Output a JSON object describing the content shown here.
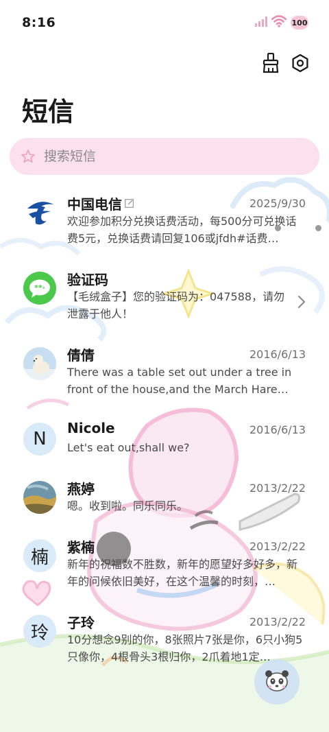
{
  "status_bar": {
    "time": "8:16",
    "battery": "100"
  },
  "header": {
    "title": "短信",
    "clean_icon": "brush-icon",
    "settings_icon": "gear-icon"
  },
  "search": {
    "placeholder": "搜索短信",
    "icon": "star-icon"
  },
  "conversations": [
    {
      "name": "中国电信",
      "date": "2025/9/30",
      "preview": "欢迎参加积分兑换话费活动，每500分可兑换话费5元，兑换话费请回复106或jfdh#话费…",
      "avatar": "china-telecom-logo",
      "has_edit_mark": true
    },
    {
      "name": "验证码",
      "date": "",
      "preview": "【毛绒盒子】您的验证码为：047588，请勿泄露于他人！",
      "avatar": "message-bubble-icon",
      "has_chevron": true
    },
    {
      "name": "倩倩",
      "date": "2016/6/13",
      "preview": "There was a table set out under a tree in front of the house,and the March Hare an…",
      "avatar": "polar-bear-photo"
    },
    {
      "name": "Nicole",
      "date": "2016/6/13",
      "preview": "Let's eat out,shall we?",
      "avatar_letter": "N"
    },
    {
      "name": "燕婷",
      "date": "2013/2/22",
      "preview": "嗯。收到啦。同乐同乐。",
      "avatar": "landscape-photo"
    },
    {
      "name": "紫楠",
      "date": "2013/2/22",
      "preview": "新年的祝福数不胜数，新年的愿望好多好多，新年的问候依旧美好，在这个温馨的时刻，…",
      "avatar_letter": "楠"
    },
    {
      "name": "子玲",
      "date": "2013/2/22",
      "preview": "10分想念9别的你，8张照片7张是你，6只小狗5只像你，4根骨头3根归你，2爪着地1定…",
      "avatar_letter": "玲"
    }
  ],
  "fab": {
    "icon": "panda-compose-icon"
  },
  "colors": {
    "search_bg": "#fcdeea",
    "letter_avatar_bg": "#d9eaf8",
    "verify_green": "#4cc94a",
    "telecom_blue": "#1a4fa3"
  }
}
